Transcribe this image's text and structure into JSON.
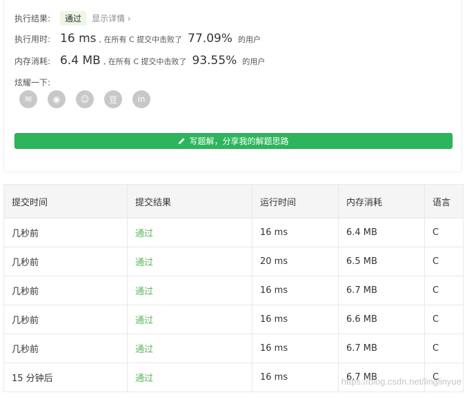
{
  "summary": {
    "result_label": "执行结果:",
    "result_badge": "通过",
    "detail_link": "显示详情 ›",
    "runtime_label": "执行用时:",
    "runtime_value": "16 ms",
    "runtime_text": ", 在所有 C 提交中击败了",
    "runtime_pct": "77.09%",
    "runtime_suffix": "的用户",
    "memory_label": "内存消耗:",
    "memory_value": "6.4 MB",
    "memory_text": ", 在所有 C 提交中击败了",
    "memory_pct": "93.55%",
    "memory_suffix": "的用户",
    "share_label": "炫耀一下:",
    "share_icons": [
      {
        "name": "wechat-icon",
        "glyph": "✉"
      },
      {
        "name": "weibo-icon",
        "glyph": "◉"
      },
      {
        "name": "qq-icon",
        "glyph": "☺"
      },
      {
        "name": "douban-icon",
        "glyph": "豆"
      },
      {
        "name": "linkedin-icon",
        "glyph": "in"
      }
    ],
    "solution_button": "写题解，分享我的解题思路",
    "accent": "#2db55d"
  },
  "table": {
    "headers": [
      "提交时间",
      "提交结果",
      "运行时间",
      "内存消耗",
      "语言"
    ],
    "rows": [
      [
        "几秒前",
        "通过",
        "16 ms",
        "6.4 MB",
        "C"
      ],
      [
        "几秒前",
        "通过",
        "20 ms",
        "6.5 MB",
        "C"
      ],
      [
        "几秒前",
        "通过",
        "16 ms",
        "6.7 MB",
        "C"
      ],
      [
        "几秒前",
        "通过",
        "16 ms",
        "6.6 MB",
        "C"
      ],
      [
        "几秒前",
        "通过",
        "16 ms",
        "6.7 MB",
        "C"
      ],
      [
        "15 分钟后",
        "通过",
        "16 ms",
        "6.7 MB",
        "C"
      ]
    ]
  },
  "watermark": "https://blog.csdn.net/linglinyue"
}
